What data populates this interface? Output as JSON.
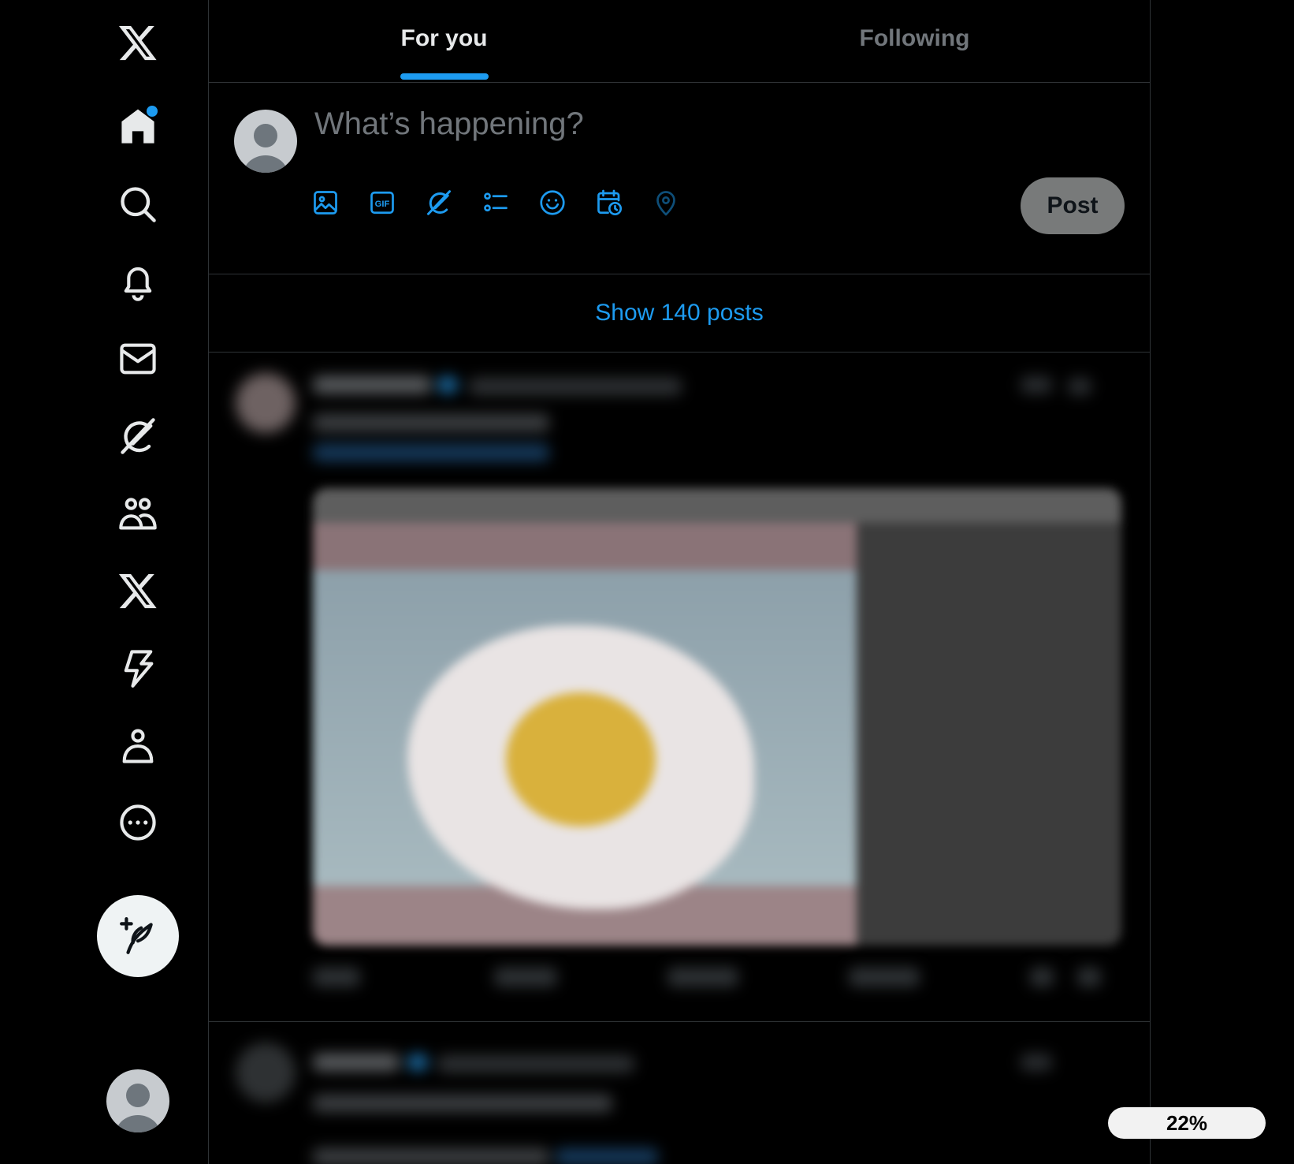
{
  "nav": {
    "items": [
      {
        "name": "x-logo",
        "icon": "x-logo-icon"
      },
      {
        "name": "home",
        "icon": "home-icon",
        "has_dot": true
      },
      {
        "name": "explore",
        "icon": "search-icon"
      },
      {
        "name": "notifications",
        "icon": "bell-icon"
      },
      {
        "name": "messages",
        "icon": "mail-icon"
      },
      {
        "name": "grok",
        "icon": "grok-icon"
      },
      {
        "name": "communities",
        "icon": "people-icon"
      },
      {
        "name": "premium",
        "icon": "x-logo-icon"
      },
      {
        "name": "verified-orgs",
        "icon": "lightning-icon"
      },
      {
        "name": "profile",
        "icon": "person-icon"
      },
      {
        "name": "more",
        "icon": "more-circle-icon"
      }
    ],
    "compose_icon": "feather-plus-icon"
  },
  "tabs": [
    {
      "label": "For you",
      "active": true
    },
    {
      "label": "Following",
      "active": false
    }
  ],
  "composer": {
    "placeholder": "What’s happening?",
    "tools": [
      "image-icon",
      "gif-icon",
      "grok-icon",
      "poll-icon",
      "emoji-icon",
      "schedule-icon",
      "location-icon"
    ],
    "post_label": "Post"
  },
  "feed": {
    "show_more_label": "Show 140 posts"
  },
  "zoom": {
    "label": "22%"
  },
  "colors": {
    "accent": "#1d9bf0",
    "background": "#000000",
    "border": "#2f3336",
    "muted_text": "#71767b",
    "post_button_disabled": "#787a7a"
  }
}
